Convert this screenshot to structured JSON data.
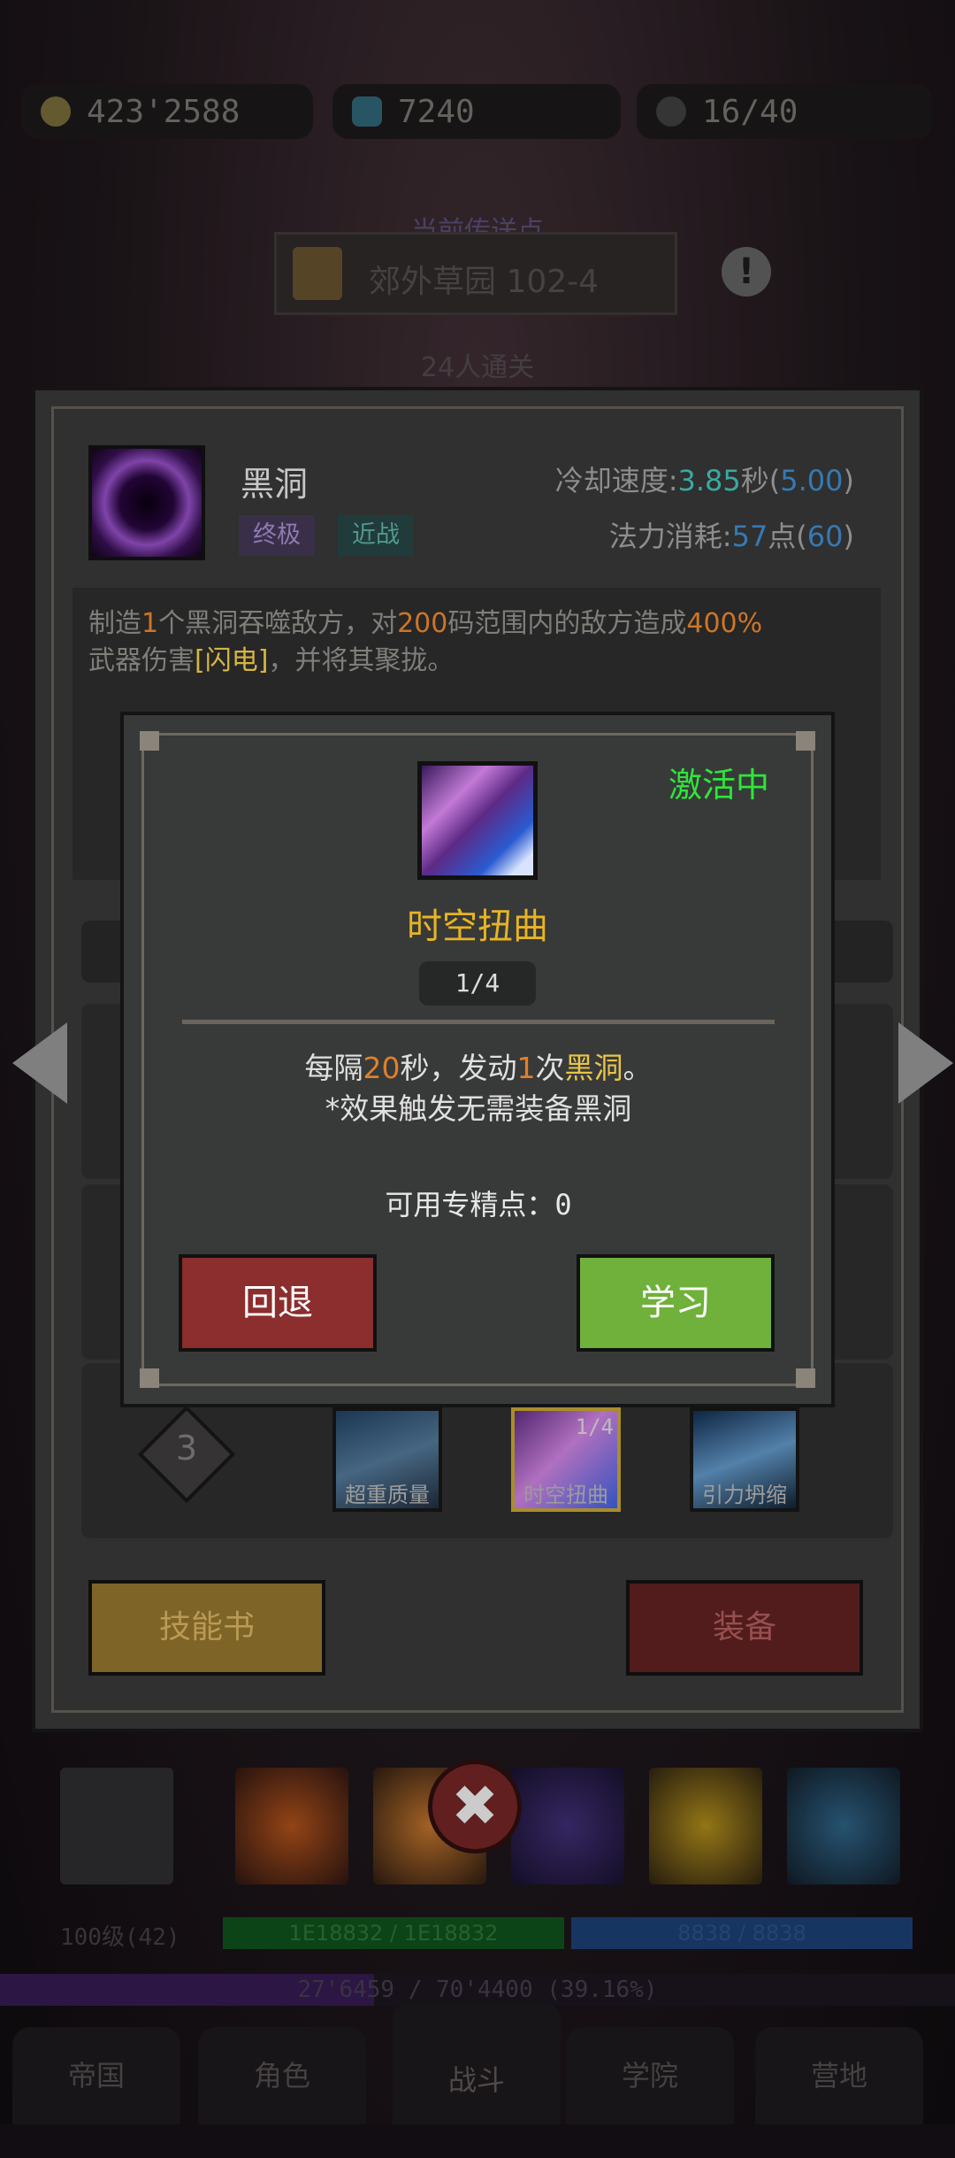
{
  "top_bar": {
    "gold": "423'2588",
    "gems": "7240",
    "stamina": "16/40"
  },
  "teleport": {
    "label": "当前传送点",
    "location": "郊外草园 102-4",
    "clear_info": "24人通关"
  },
  "skill": {
    "name": "黑洞",
    "tags": [
      "终极",
      "近战"
    ],
    "cooldown_label": "冷却速度:",
    "cooldown_value": "3.85",
    "cooldown_unit": "秒(",
    "cooldown_base": "5.00",
    "cooldown_close": ")",
    "mana_label": "法力消耗:",
    "mana_value": "57",
    "mana_unit": "点(",
    "mana_base": "60",
    "mana_close": ")",
    "desc_1": "制造",
    "desc_n1": "1",
    "desc_2": "个黑洞吞噬敌方，对",
    "desc_n2": "200",
    "desc_3": "码范围内的敌方造成",
    "desc_n3": "400%",
    "desc_4": "武器伤害",
    "desc_element": "[闪电]",
    "desc_5": "，并将其聚拢。"
  },
  "talent_row": {
    "tier": "3",
    "cards": [
      {
        "name": "超重质量",
        "level": ""
      },
      {
        "name": "时空扭曲",
        "level": "1/4"
      },
      {
        "name": "引力坍缩",
        "level": ""
      }
    ]
  },
  "panel_buttons": {
    "skill_book": "技能书",
    "equip": "装备"
  },
  "modal": {
    "status": "激活中",
    "talent_name": "时空扭曲",
    "level": "1/4",
    "effect_1": "每隔",
    "effect_n1": "20",
    "effect_2": "秒，发动",
    "effect_n2": "1",
    "effect_3": "次",
    "effect_skill": "黑洞",
    "effect_4": "。",
    "effect_note": "*效果触发无需装备黑洞",
    "points_label": "可用专精点：",
    "points_value": "0",
    "back_button": "回退",
    "learn_button": "学习"
  },
  "bottom": {
    "hero_level": "100级(42)",
    "hp": "1E18832 / 1E18832",
    "mp": "8838 / 8838",
    "exp": "27'6459 / 70'4400 (39.16%)",
    "nav": [
      "帝国",
      "角色",
      "战斗",
      "学院",
      "营地"
    ]
  },
  "colors": {
    "highlight_orange": "#e07f2a",
    "highlight_yellow": "#e8c44a",
    "status_green": "#2ee63a",
    "back_red": "#8b2e2d",
    "learn_green": "#6fb13a"
  }
}
